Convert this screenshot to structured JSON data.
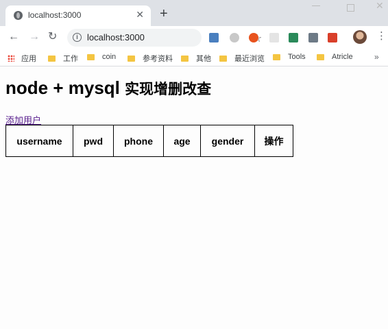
{
  "browser": {
    "tab_title": "localhost:3000",
    "address": "localhost:3000",
    "bookmarks": [
      "应用",
      "工作",
      "coin",
      "参考资料",
      "其他",
      "最近浏览",
      "Tools",
      "Atricle"
    ],
    "bookmarks_more": "»"
  },
  "page": {
    "title": "node + mysql ",
    "title_cn": "实现增删改查",
    "add_user_link": "添加用户",
    "table_headers": [
      "username",
      "pwd",
      "phone",
      "age",
      "gender",
      "操作"
    ]
  },
  "colors": {
    "link_visited": "#551a8b",
    "tab_strip": "#dee1e6"
  }
}
